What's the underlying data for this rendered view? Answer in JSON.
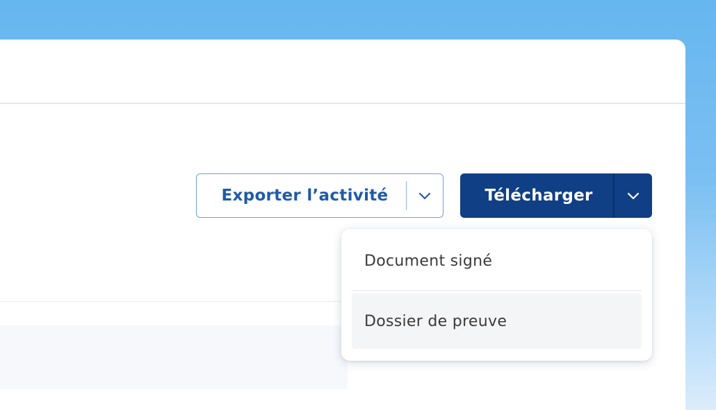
{
  "actions": {
    "export": {
      "label": "Exporter l’activité",
      "toggle_icon": "chevron-down-icon"
    },
    "download": {
      "label": "Télécharger",
      "toggle_icon": "chevron-down-icon"
    }
  },
  "download_menu": {
    "items": [
      {
        "label": "Document signé"
      },
      {
        "label": "Dossier de preuve",
        "state": "hovered"
      }
    ]
  },
  "colors": {
    "primary": "#103f85",
    "outline_blue": "#1f5ba8",
    "background_gradient_top": "#66b6f0",
    "surface": "#ffffff"
  }
}
